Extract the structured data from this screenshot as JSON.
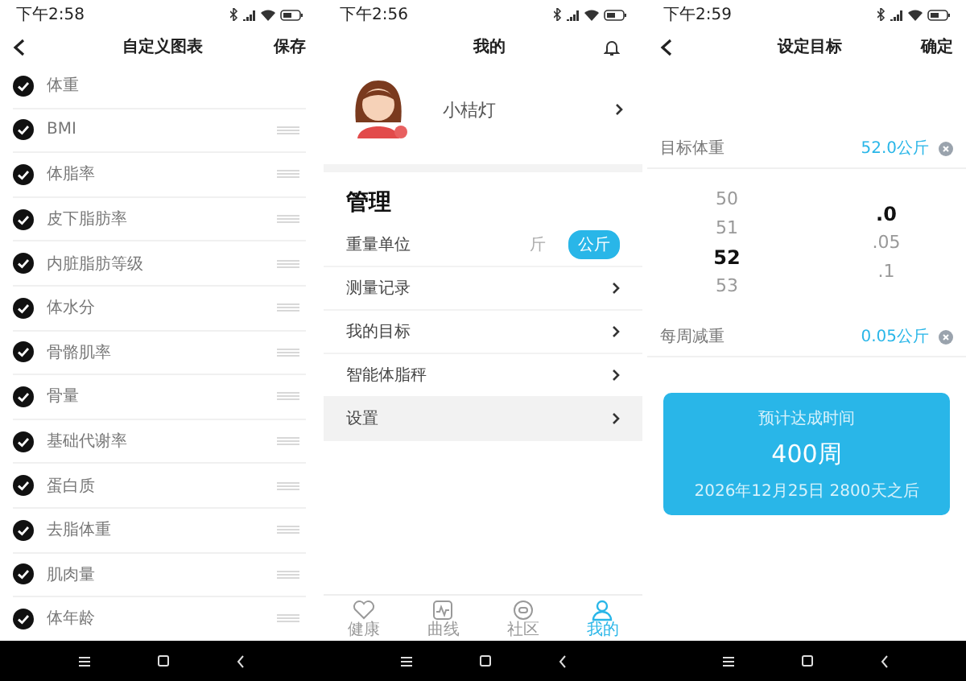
{
  "screens": [
    {
      "kind": "list",
      "status_bar": {
        "time": "下午2:58"
      },
      "header": {
        "title": "自定义图表",
        "action": "保存"
      },
      "items": [
        {
          "label": "体重",
          "checked": true,
          "draggable": false
        },
        {
          "label": "BMI",
          "checked": true,
          "draggable": true
        },
        {
          "label": "体脂率",
          "checked": true,
          "draggable": true
        },
        {
          "label": "皮下脂肪率",
          "checked": true,
          "draggable": true
        },
        {
          "label": "内脏脂肪等级",
          "checked": true,
          "draggable": true
        },
        {
          "label": "体水分",
          "checked": true,
          "draggable": true
        },
        {
          "label": "骨骼肌率",
          "checked": true,
          "draggable": true
        },
        {
          "label": "骨量",
          "checked": true,
          "draggable": true
        },
        {
          "label": "基础代谢率",
          "checked": true,
          "draggable": true
        },
        {
          "label": "蛋白质",
          "checked": true,
          "draggable": true
        },
        {
          "label": "去脂体重",
          "checked": true,
          "draggable": true
        },
        {
          "label": "肌肉量",
          "checked": true,
          "draggable": true
        },
        {
          "label": "体年龄",
          "checked": true,
          "draggable": true
        }
      ]
    },
    {
      "kind": "profile",
      "status_bar": {
        "time": "下午2:56"
      },
      "header": {
        "title": "我的"
      },
      "profile": {
        "name": "小桔灯"
      },
      "section": "管理",
      "rows": [
        {
          "label": "重量单位",
          "kind": "units",
          "units": [
            {
              "label": "斤",
              "selected": false
            },
            {
              "label": "公斤",
              "selected": true
            }
          ]
        },
        {
          "label": "测量记录",
          "kind": "link"
        },
        {
          "label": "我的目标",
          "kind": "link"
        },
        {
          "label": "智能体脂秤",
          "kind": "link"
        },
        {
          "label": "设置",
          "kind": "link"
        }
      ],
      "tabs": [
        {
          "label": "健康",
          "selected": false
        },
        {
          "label": "曲线",
          "selected": false
        },
        {
          "label": "社区",
          "selected": false
        },
        {
          "label": "我的",
          "selected": true
        }
      ]
    },
    {
      "kind": "goal",
      "status_bar": {
        "time": "下午2:59"
      },
      "header": {
        "title": "设定目标",
        "action": "确定"
      },
      "target": {
        "label": "目标体重",
        "value": "52.0公斤"
      },
      "picker": [
        [
          {
            "label": "50",
            "selected": false
          },
          {
            "label": "51",
            "selected": false
          },
          {
            "label": "52",
            "selected": true
          },
          {
            "label": "53",
            "selected": false
          }
        ],
        [
          {
            "label": ".0",
            "selected": true
          },
          {
            "label": ".05",
            "selected": false
          },
          {
            "label": ".1",
            "selected": false
          }
        ]
      ],
      "weekly": {
        "label": "每周减重",
        "value": "0.05公斤"
      },
      "estimate": {
        "caption": "预计达成时间",
        "value": "400周",
        "date": "2026年12月25日 2800天之后"
      }
    }
  ]
}
